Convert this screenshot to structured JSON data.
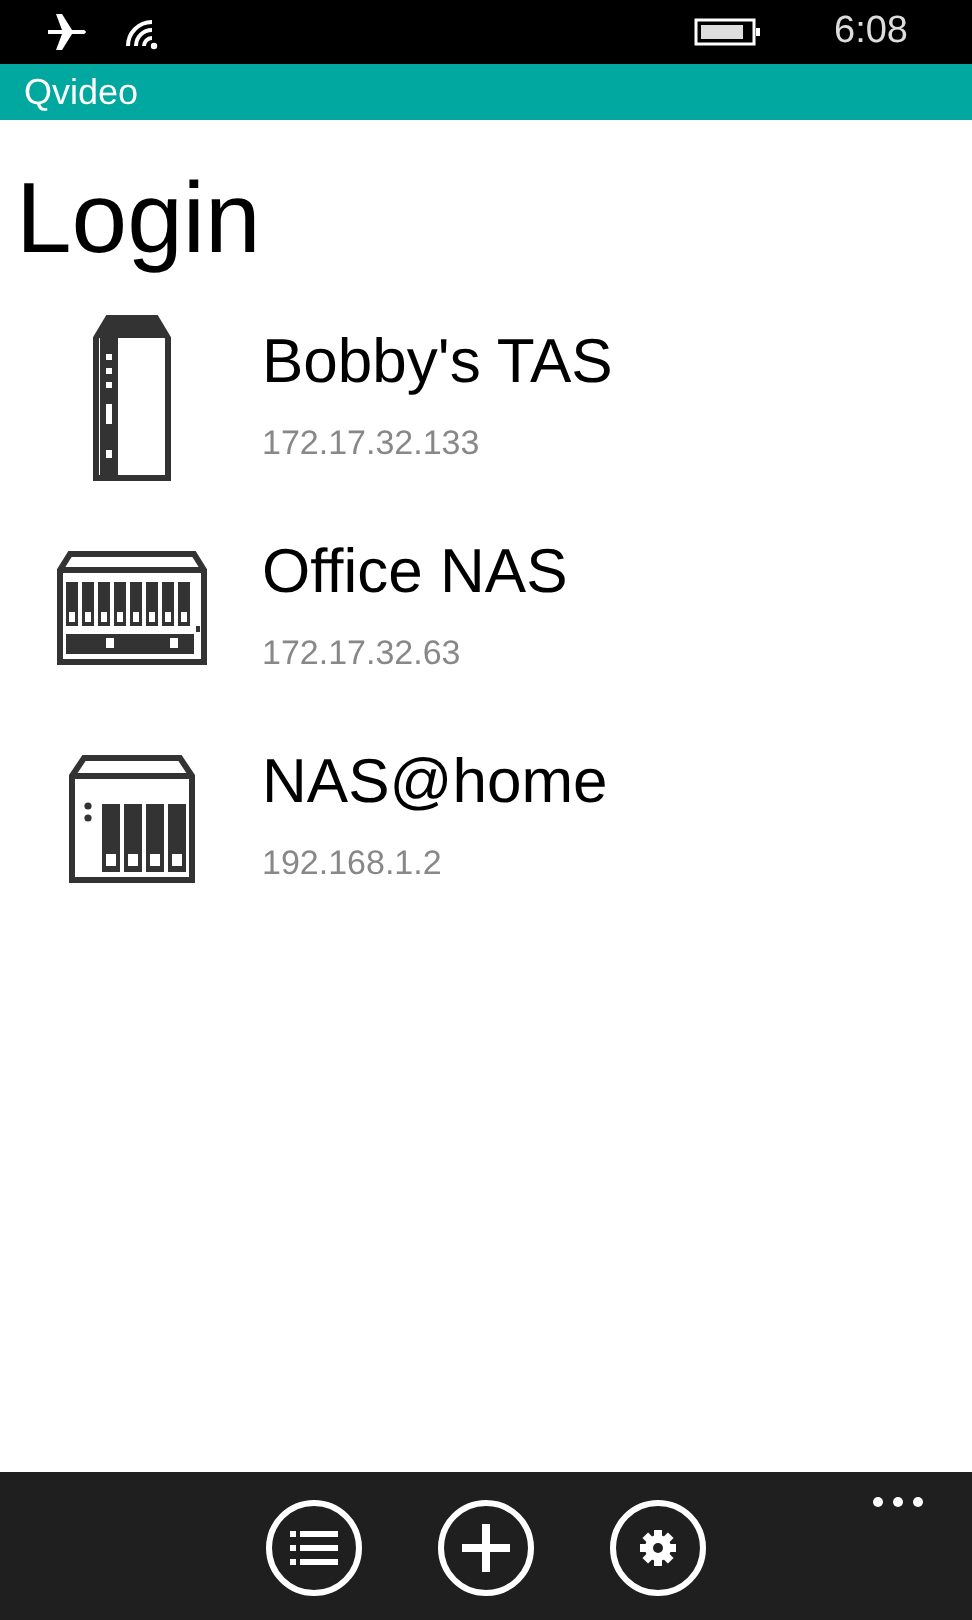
{
  "status_bar": {
    "time": "6:08"
  },
  "app_bar": {
    "title": "Qvideo"
  },
  "page": {
    "title": "Login"
  },
  "devices": [
    {
      "kind": "tower",
      "name": "Bobby's TAS",
      "address": "172.17.32.133"
    },
    {
      "kind": "rack",
      "name": "Office NAS",
      "address": "172.17.32.63"
    },
    {
      "kind": "box",
      "name": "NAS@home",
      "address": "192.168.1.2"
    }
  ]
}
